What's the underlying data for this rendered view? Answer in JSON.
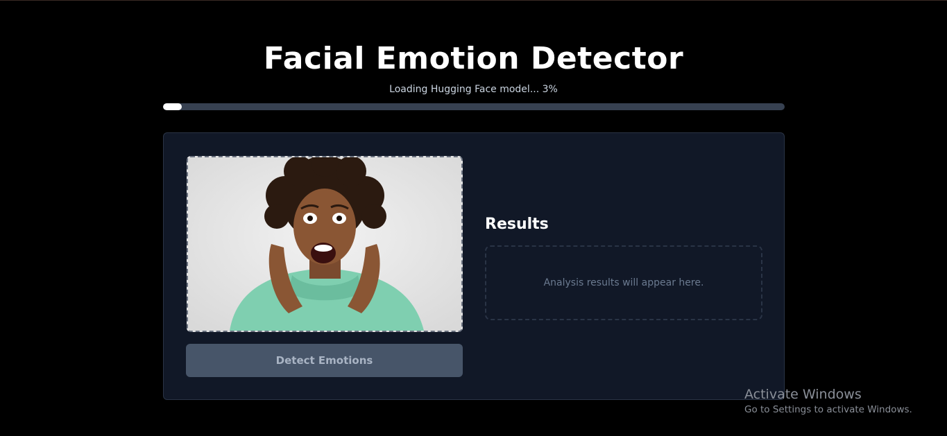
{
  "header": {
    "title": "Facial Emotion Detector",
    "status": "Loading Hugging Face model... 3%",
    "progress": 0.03
  },
  "upload": {
    "image_alt": "Uploaded photo of a frightened man with curly hair in a mint sweater",
    "detect_label": "Detect Emotions"
  },
  "results": {
    "heading": "Results",
    "placeholder": "Analysis results will appear here."
  },
  "watermark": {
    "title": "Activate Windows",
    "subtitle": "Go to Settings to activate Windows."
  },
  "colors": {
    "background": "#000000",
    "card": "#111827",
    "progress_track": "#374151",
    "progress_fill": "#ffffff",
    "button": "#475569"
  }
}
